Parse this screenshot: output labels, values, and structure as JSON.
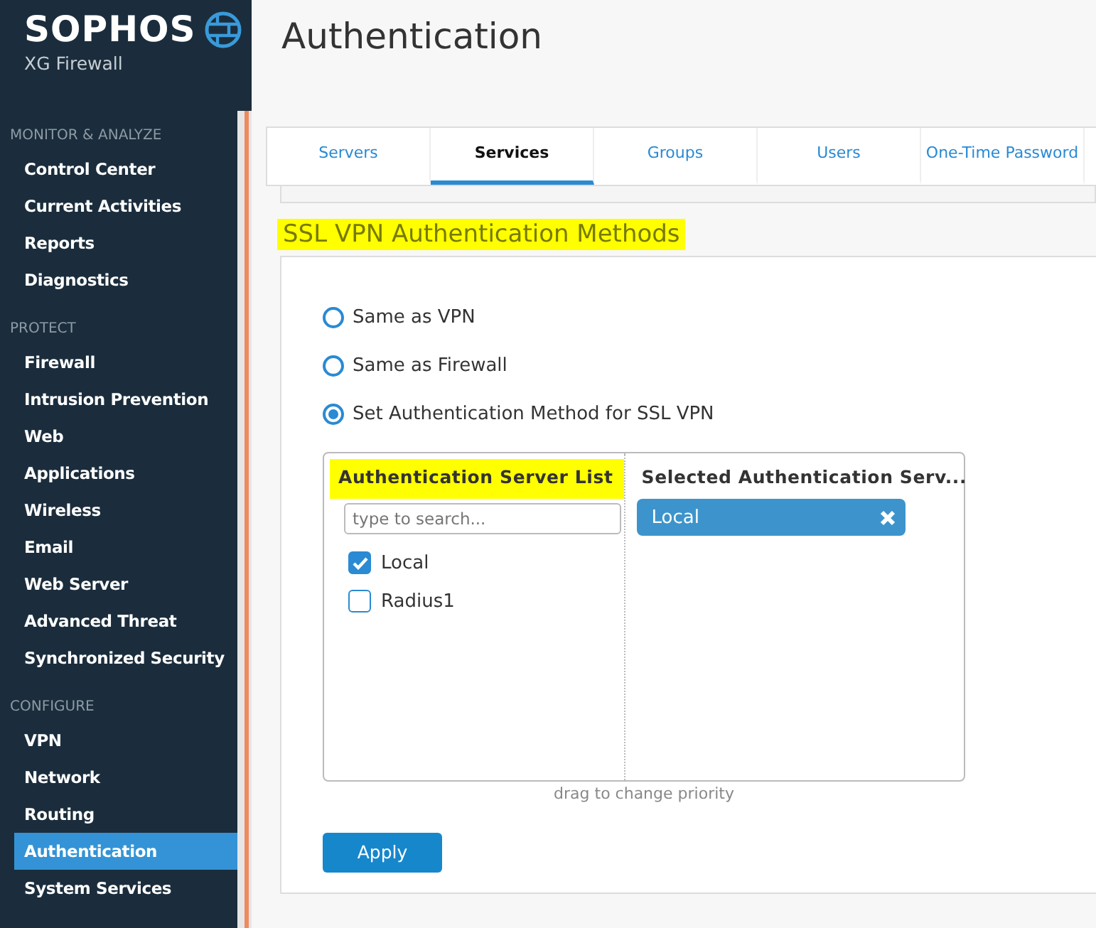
{
  "brand": {
    "name": "SOPHOS",
    "product": "XG Firewall"
  },
  "sidebar": [
    {
      "heading": "MONITOR & ANALYZE",
      "items": [
        {
          "label": "Control Center",
          "selected": false
        },
        {
          "label": "Current Activities",
          "selected": false
        },
        {
          "label": "Reports",
          "selected": false
        },
        {
          "label": "Diagnostics",
          "selected": false
        }
      ]
    },
    {
      "heading": "PROTECT",
      "items": [
        {
          "label": "Firewall",
          "selected": false
        },
        {
          "label": "Intrusion Prevention",
          "selected": false
        },
        {
          "label": "Web",
          "selected": false
        },
        {
          "label": "Applications",
          "selected": false
        },
        {
          "label": "Wireless",
          "selected": false
        },
        {
          "label": "Email",
          "selected": false
        },
        {
          "label": "Web Server",
          "selected": false
        },
        {
          "label": "Advanced Threat",
          "selected": false
        },
        {
          "label": "Synchronized Security",
          "selected": false
        }
      ]
    },
    {
      "heading": "CONFIGURE",
      "items": [
        {
          "label": "VPN",
          "selected": false
        },
        {
          "label": "Network",
          "selected": false
        },
        {
          "label": "Routing",
          "selected": false
        },
        {
          "label": "Authentication",
          "selected": true
        },
        {
          "label": "System Services",
          "selected": false
        }
      ]
    }
  ],
  "page_title": "Authentication",
  "tabs": [
    {
      "label": "Servers",
      "selected": false
    },
    {
      "label": "Services",
      "selected": true
    },
    {
      "label": "Groups",
      "selected": false
    },
    {
      "label": "Users",
      "selected": false
    },
    {
      "label": "One-Time Password",
      "selected": false
    }
  ],
  "section": {
    "title": "SSL VPN Authentication Methods",
    "highlighted": true,
    "options": [
      {
        "label": "Same as VPN",
        "selected": false
      },
      {
        "label": "Same as Firewall",
        "selected": false
      },
      {
        "label": "Set Authentication Method for SSL VPN",
        "selected": true
      }
    ],
    "server_list": {
      "title": "Authentication Server List",
      "highlighted": true,
      "search": {
        "placeholder": "type to search..."
      },
      "items": [
        {
          "label": "Local",
          "checked": true
        },
        {
          "label": "Radius1",
          "checked": false
        }
      ]
    },
    "selected_list": {
      "title": "Selected Authentication Serv...",
      "items": [
        {
          "label": "Local"
        }
      ]
    },
    "hint": "drag to change priority",
    "apply": "Apply"
  }
}
